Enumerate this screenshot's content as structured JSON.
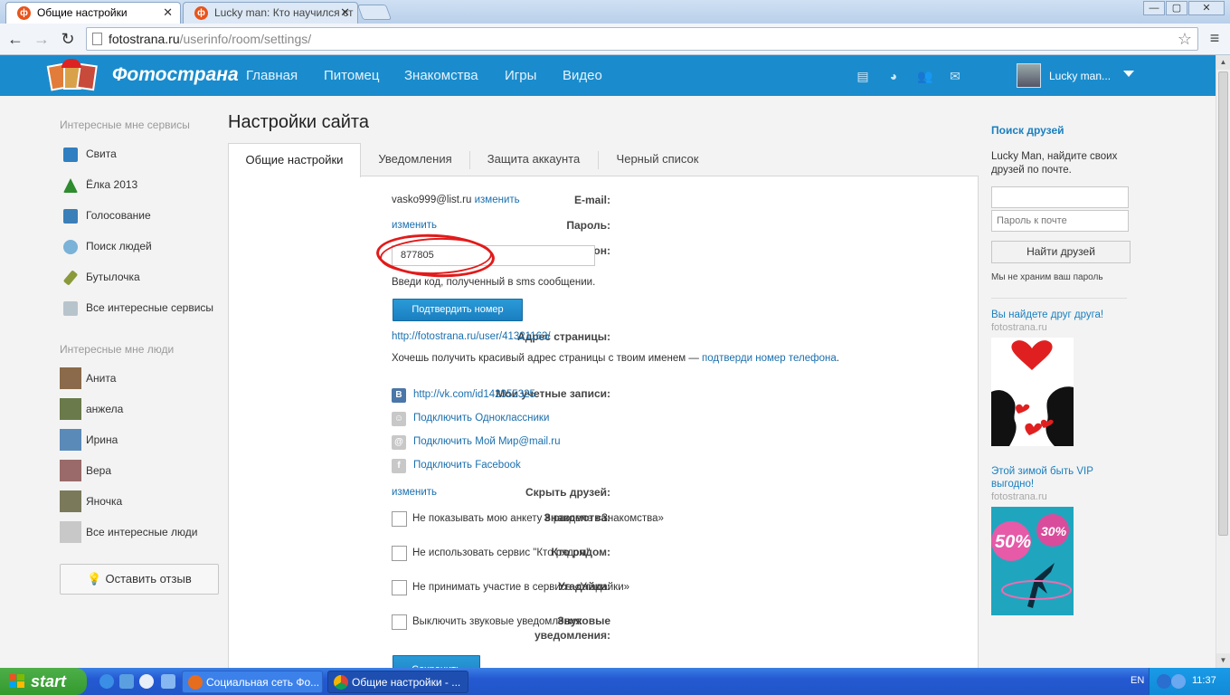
{
  "browser": {
    "tabs": [
      {
        "title": "Общие настройки",
        "close": "✕"
      },
      {
        "title": "Lucky man: Кто научился ст",
        "close": "✕"
      }
    ],
    "url_host": "fotostrana.ru",
    "url_path": "/userinfo/room/settings/",
    "window_controls": {
      "minimize": "—",
      "maximize": "▢",
      "close": "✕"
    }
  },
  "site": {
    "logo_text": "Фотострана",
    "nav": [
      "Главная",
      "Питомец",
      "Знакомства",
      "Игры",
      "Видео"
    ],
    "user_name": "Lucky man..."
  },
  "left": {
    "services_title": "Интересные мне сервисы",
    "services": [
      {
        "label": "Свита",
        "icon": "crown-icon",
        "color": "#2f7fc1"
      },
      {
        "label": "Ёлка 2013",
        "icon": "tree-icon",
        "color": "#2e8b2e"
      },
      {
        "label": "Голосование",
        "icon": "vote-icon",
        "color": "#3a7fb8"
      },
      {
        "label": "Поиск людей",
        "icon": "search-people-icon",
        "color": "#7ab2d8"
      },
      {
        "label": "Бутылочка",
        "icon": "bottle-icon",
        "color": "#8a9a3a"
      },
      {
        "label": "Все интересные сервисы",
        "icon": "services-icon",
        "color": "#b8c4cc"
      }
    ],
    "people_title": "Интересные мне люди",
    "people": [
      {
        "label": "Анита",
        "color": "#8a6a4a"
      },
      {
        "label": "анжела",
        "color": "#6a7a4a"
      },
      {
        "label": "Ирина",
        "color": "#5a8ab8"
      },
      {
        "label": "Вера",
        "color": "#9a6a6a"
      },
      {
        "label": "Яночка",
        "color": "#7a7a5a"
      },
      {
        "label": "Все интересные люди",
        "color": "#c8c8c8"
      }
    ],
    "feedback_button": "Оставить отзыв"
  },
  "main": {
    "page_title": "Настройки сайта",
    "tabs": [
      "Общие настройки",
      "Уведомления",
      "Защита аккаунта",
      "Черный список"
    ],
    "email_label": "E-mail:",
    "email_value": "vasko999@list.ru",
    "email_change": "изменить",
    "password_label": "Пароль:",
    "password_change": "изменить",
    "phone_label": "Телефон:",
    "phone_value": "877805",
    "phone_hint": "Введи код, полученный в sms сообщении.",
    "confirm_button": "Подтвердить номер",
    "address_label": "Адрес страницы:",
    "address_value": "http://fotostrana.ru/user/41321163/",
    "address_hint_prefix": "Хочешь получить красивый адрес страницы с твоим именем — ",
    "address_hint_link": "подтверди номер телефона",
    "address_hint_suffix": ".",
    "accounts_label": "Мои учетные записи:",
    "accounts": [
      {
        "text": "http://vk.com/id142355325",
        "icon": "vk-icon",
        "glyph": "В",
        "color": "#4a76a8"
      },
      {
        "text": "Подключить Одноклассники",
        "icon": "odnoklassniki-icon",
        "glyph": "ok",
        "color": "#c8c8c8"
      },
      {
        "text": "Подключить Мой Мир@mail.ru",
        "icon": "mailru-icon",
        "glyph": "@",
        "color": "#c8c8c8"
      },
      {
        "text": "Подключить Facebook",
        "icon": "facebook-icon",
        "glyph": "f",
        "color": "#c8c8c8"
      }
    ],
    "hide_friends_label": "Скрыть друзей:",
    "hide_friends_change": "изменить",
    "dating_label": "Знакомства:",
    "dating_option": "Не показывать мою анкету в разделе «Знакомства»",
    "nearby_label": "Кто рядом:",
    "nearby_option": "Не использовать сервис \"Кто рядом\"",
    "guess_label": "Угадайки:",
    "guess_option": "Не принимать участие в сервисе «Угадайки»",
    "sound_label_1": "Звуковые",
    "sound_label_2": "уведомления:",
    "sound_option": "Выключить звуковые уведомления",
    "save_button": "Сохранить"
  },
  "right": {
    "find_title": "Поиск друзей",
    "find_text": "Lucky Man, найдите своих друзей по почте.",
    "email_placeholder": "",
    "password_placeholder": "Пароль к почте",
    "find_button": "Найти друзей",
    "note": "Мы не храним ваш пароль",
    "ad1_title": "Вы найдете друг друга!",
    "ad1_src": "fotostrana.ru",
    "ad2_title": "Этой зимой быть VIP выгодно!",
    "ad2_src": "fotostrana.ru",
    "ad2_badge1": "50%",
    "ad2_badge2": "30%"
  },
  "taskbar": {
    "start": "start",
    "tasks": [
      "Социальная сеть Фо...",
      "Общие настройки - ..."
    ],
    "lang": "EN",
    "time": "11:37"
  }
}
